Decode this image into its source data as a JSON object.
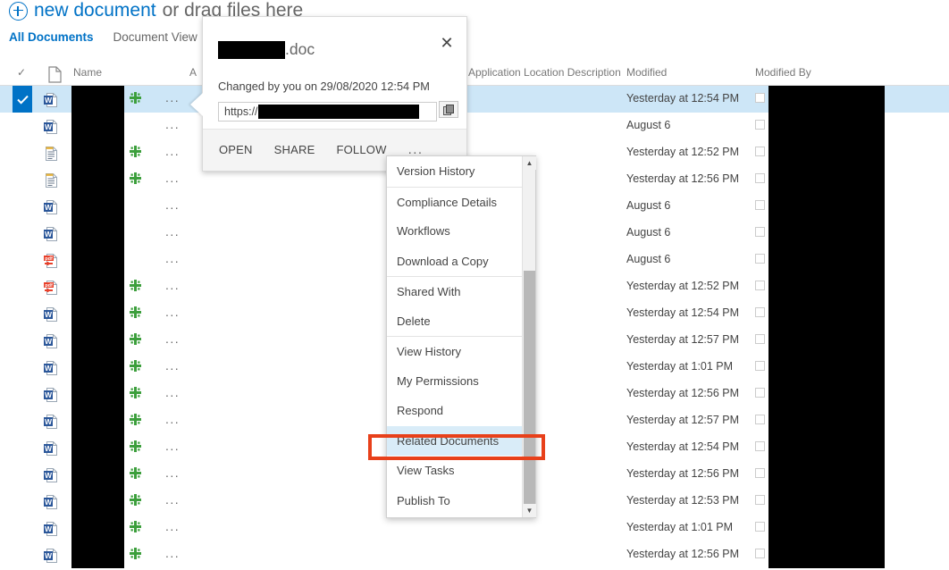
{
  "toolbar": {
    "new_document_link": "new document",
    "new_document_rest": "or drag files here",
    "plus_icon": "plus-circle-icon"
  },
  "view_tabs": [
    {
      "label": "All Documents",
      "active": true
    },
    {
      "label": "Document View",
      "active": false
    }
  ],
  "list_header": {
    "check_icon": "checkmark-icon",
    "doc_icon": "document-icon",
    "name": "Name",
    "a_partial": "A",
    "application_location_description": "Application Location Description",
    "modified": "Modified",
    "modified_by": "Modified By"
  },
  "rows": [
    {
      "icon": "word-doc-icon",
      "selected": true,
      "flag": true,
      "ellipsis": "...",
      "modified": "Yesterday at 12:54 PM"
    },
    {
      "icon": "word-doc-icon",
      "selected": false,
      "flag": false,
      "ellipsis": "...",
      "modified": "August 6"
    },
    {
      "icon": "text-doc-icon",
      "selected": false,
      "flag": true,
      "ellipsis": "...",
      "modified": "Yesterday at 12:52 PM"
    },
    {
      "icon": "text-doc-icon",
      "selected": false,
      "flag": true,
      "ellipsis": "...",
      "modified": "Yesterday at 12:56 PM"
    },
    {
      "icon": "word-doc-icon",
      "selected": false,
      "flag": false,
      "ellipsis": "...",
      "modified": "August 6"
    },
    {
      "icon": "word-doc-icon",
      "selected": false,
      "flag": false,
      "ellipsis": "...",
      "modified": "August 6"
    },
    {
      "icon": "pdf-doc-icon",
      "selected": false,
      "flag": false,
      "ellipsis": "...",
      "modified": "August 6"
    },
    {
      "icon": "pdf-doc-icon",
      "selected": false,
      "flag": true,
      "ellipsis": "...",
      "modified": "Yesterday at 12:52 PM"
    },
    {
      "icon": "word-doc-icon",
      "selected": false,
      "flag": true,
      "ellipsis": "...",
      "modified": "Yesterday at 12:54 PM"
    },
    {
      "icon": "word-doc-icon",
      "selected": false,
      "flag": true,
      "ellipsis": "...",
      "modified": "Yesterday at 12:57 PM"
    },
    {
      "icon": "word-doc-icon",
      "selected": false,
      "flag": true,
      "ellipsis": "...",
      "modified": "Yesterday at 1:01 PM"
    },
    {
      "icon": "word-doc-icon",
      "selected": false,
      "flag": true,
      "ellipsis": "...",
      "modified": "Yesterday at 12:56 PM"
    },
    {
      "icon": "word-doc-icon",
      "selected": false,
      "flag": true,
      "ellipsis": "...",
      "modified": "Yesterday at 12:57 PM"
    },
    {
      "icon": "word-doc-icon",
      "selected": false,
      "flag": true,
      "ellipsis": "...",
      "modified": "Yesterday at 12:54 PM"
    },
    {
      "icon": "word-doc-icon",
      "selected": false,
      "flag": true,
      "ellipsis": "...",
      "modified": "Yesterday at 12:56 PM"
    },
    {
      "icon": "word-doc-icon",
      "selected": false,
      "flag": true,
      "ellipsis": "...",
      "modified": "Yesterday at 12:53 PM"
    },
    {
      "icon": "word-doc-icon",
      "selected": false,
      "flag": true,
      "ellipsis": "...",
      "modified": "Yesterday at 1:01 PM"
    },
    {
      "icon": "word-doc-icon",
      "selected": false,
      "flag": true,
      "ellipsis": "...",
      "modified": "Yesterday at 12:56 PM"
    }
  ],
  "callout": {
    "file_extension": ".doc",
    "close_icon": "close-icon",
    "changed_text": "Changed by you on 29/08/2020 12:54 PM",
    "url_scheme": "https://",
    "copy_icon": "copy-link-icon",
    "actions": [
      {
        "label": "OPEN"
      },
      {
        "label": "SHARE"
      },
      {
        "label": "FOLLOW"
      }
    ],
    "more_actions": "..."
  },
  "context_menu": {
    "items": [
      {
        "label": "Version History",
        "separator": false,
        "highlighted": false
      },
      {
        "label": "Compliance Details",
        "separator": true,
        "highlighted": false
      },
      {
        "label": "Workflows",
        "separator": false,
        "highlighted": false
      },
      {
        "label": "Download a Copy",
        "separator": false,
        "highlighted": false
      },
      {
        "label": "Shared With",
        "separator": true,
        "highlighted": false
      },
      {
        "label": "Delete",
        "separator": false,
        "highlighted": false
      },
      {
        "label": "View History",
        "separator": true,
        "highlighted": false
      },
      {
        "label": "My Permissions",
        "separator": false,
        "highlighted": false
      },
      {
        "label": "Respond",
        "separator": false,
        "highlighted": false
      },
      {
        "label": "Related Documents",
        "separator": false,
        "highlighted": true
      },
      {
        "label": "View Tasks",
        "separator": false,
        "highlighted": false
      },
      {
        "label": "Publish To",
        "separator": false,
        "highlighted": false
      }
    ],
    "scroll_up_icon": "scroll-up-arrow-icon",
    "scroll_down_icon": "scroll-down-arrow-icon",
    "scrollbar": "vertical-scrollbar"
  },
  "annotation": {
    "highlight_color": "#e8401a",
    "highlight_target": "Related Documents"
  },
  "colors": {
    "accent": "#0072c6",
    "selection": "#cde6f7",
    "menu_highlight": "#d9ecf8"
  }
}
